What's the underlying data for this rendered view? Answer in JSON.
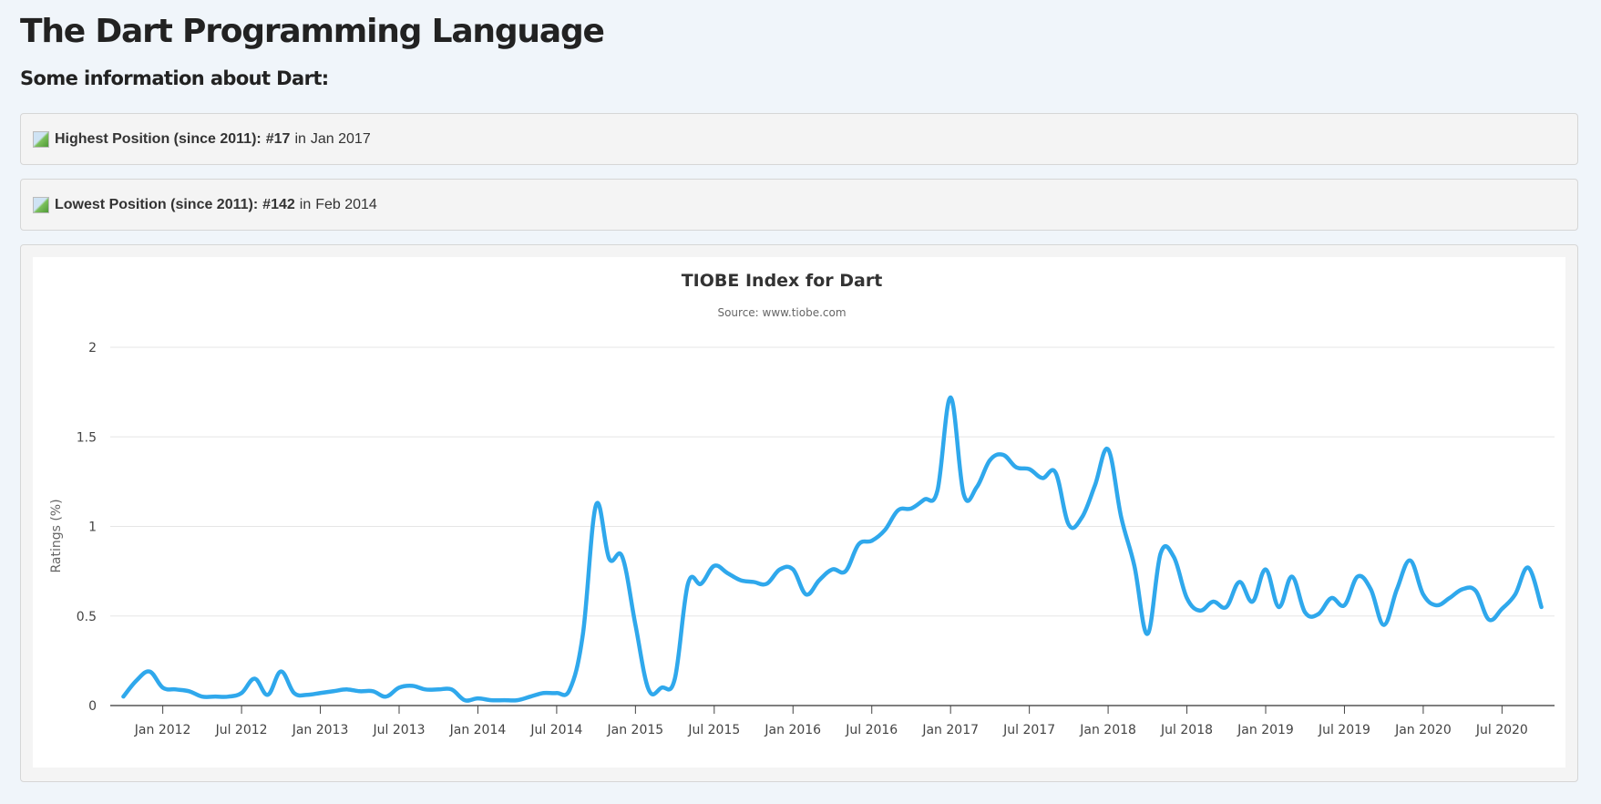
{
  "page": {
    "title": "The Dart Programming Language",
    "subtitle": "Some information about Dart:"
  },
  "highest": {
    "icon": "trend-image-icon",
    "label": "Highest Position (since 2011):",
    "value": "#17",
    "sep": "in",
    "date": "Jan 2017"
  },
  "lowest": {
    "icon": "trend-image-icon",
    "label": "Lowest Position (since 2011):",
    "value": "#142",
    "sep": "in",
    "date": "Feb 2014"
  },
  "chart_data": {
    "type": "line",
    "title": "TIOBE Index for Dart",
    "subtitle": "Source: www.tiobe.com",
    "xlabel": "",
    "ylabel": "Ratings (%)",
    "ylim": [
      0,
      2
    ],
    "xlim": [
      "2011-09",
      "2020-11"
    ],
    "yticks": [
      0,
      0.5,
      1,
      1.5,
      2
    ],
    "ytick_labels": [
      "0",
      "0.5",
      "1",
      "1.5",
      "2"
    ],
    "xticks": [
      "2012-01",
      "2012-07",
      "2013-01",
      "2013-07",
      "2014-01",
      "2014-07",
      "2015-01",
      "2015-07",
      "2016-01",
      "2016-07",
      "2017-01",
      "2017-07",
      "2018-01",
      "2018-07",
      "2019-01",
      "2019-07",
      "2020-01",
      "2020-07"
    ],
    "xtick_labels": [
      "Jan 2012",
      "Jul 2012",
      "Jan 2013",
      "Jul 2013",
      "Jan 2014",
      "Jul 2014",
      "Jan 2015",
      "Jul 2015",
      "Jan 2016",
      "Jul 2016",
      "Jan 2017",
      "Jul 2017",
      "Jan 2018",
      "Jul 2018",
      "Jan 2019",
      "Jul 2019",
      "Jan 2020",
      "Jul 2020"
    ],
    "grid": true,
    "legend": false,
    "series": [
      {
        "color": "#2fa8ec",
        "points": [
          [
            "2011-10",
            0.05
          ],
          [
            "2011-11",
            0.14
          ],
          [
            "2011-12",
            0.19
          ],
          [
            "2012-01",
            0.1
          ],
          [
            "2012-02",
            0.09
          ],
          [
            "2012-03",
            0.08
          ],
          [
            "2012-04",
            0.05
          ],
          [
            "2012-05",
            0.05
          ],
          [
            "2012-06",
            0.05
          ],
          [
            "2012-07",
            0.07
          ],
          [
            "2012-08",
            0.15
          ],
          [
            "2012-09",
            0.06
          ],
          [
            "2012-10",
            0.19
          ],
          [
            "2012-11",
            0.07
          ],
          [
            "2012-12",
            0.06
          ],
          [
            "2013-01",
            0.07
          ],
          [
            "2013-02",
            0.08
          ],
          [
            "2013-03",
            0.09
          ],
          [
            "2013-04",
            0.08
          ],
          [
            "2013-05",
            0.08
          ],
          [
            "2013-06",
            0.05
          ],
          [
            "2013-07",
            0.1
          ],
          [
            "2013-08",
            0.11
          ],
          [
            "2013-09",
            0.09
          ],
          [
            "2013-10",
            0.09
          ],
          [
            "2013-11",
            0.09
          ],
          [
            "2013-12",
            0.03
          ],
          [
            "2014-01",
            0.04
          ],
          [
            "2014-02",
            0.03
          ],
          [
            "2014-03",
            0.03
          ],
          [
            "2014-04",
            0.03
          ],
          [
            "2014-05",
            0.05
          ],
          [
            "2014-06",
            0.07
          ],
          [
            "2014-07",
            0.07
          ],
          [
            "2014-08",
            0.09
          ],
          [
            "2014-09",
            0.4
          ],
          [
            "2014-10",
            1.12
          ],
          [
            "2014-11",
            0.82
          ],
          [
            "2014-12",
            0.83
          ],
          [
            "2015-01",
            0.45
          ],
          [
            "2015-02",
            0.09
          ],
          [
            "2015-03",
            0.1
          ],
          [
            "2015-04",
            0.15
          ],
          [
            "2015-05",
            0.68
          ],
          [
            "2015-06",
            0.68
          ],
          [
            "2015-07",
            0.78
          ],
          [
            "2015-08",
            0.74
          ],
          [
            "2015-09",
            0.7
          ],
          [
            "2015-10",
            0.69
          ],
          [
            "2015-11",
            0.68
          ],
          [
            "2015-12",
            0.76
          ],
          [
            "2016-01",
            0.76
          ],
          [
            "2016-02",
            0.62
          ],
          [
            "2016-03",
            0.7
          ],
          [
            "2016-04",
            0.76
          ],
          [
            "2016-05",
            0.75
          ],
          [
            "2016-06",
            0.9
          ],
          [
            "2016-07",
            0.92
          ],
          [
            "2016-08",
            0.98
          ],
          [
            "2016-09",
            1.09
          ],
          [
            "2016-10",
            1.1
          ],
          [
            "2016-11",
            1.15
          ],
          [
            "2016-12",
            1.2
          ],
          [
            "2017-01",
            1.72
          ],
          [
            "2017-02",
            1.18
          ],
          [
            "2017-03",
            1.22
          ],
          [
            "2017-04",
            1.37
          ],
          [
            "2017-05",
            1.4
          ],
          [
            "2017-06",
            1.33
          ],
          [
            "2017-07",
            1.32
          ],
          [
            "2017-08",
            1.27
          ],
          [
            "2017-09",
            1.3
          ],
          [
            "2017-10",
            1.01
          ],
          [
            "2017-11",
            1.05
          ],
          [
            "2017-12",
            1.23
          ],
          [
            "2018-01",
            1.43
          ],
          [
            "2018-02",
            1.05
          ],
          [
            "2018-03",
            0.78
          ],
          [
            "2018-04",
            0.4
          ],
          [
            "2018-05",
            0.85
          ],
          [
            "2018-06",
            0.83
          ],
          [
            "2018-07",
            0.6
          ],
          [
            "2018-08",
            0.53
          ],
          [
            "2018-09",
            0.58
          ],
          [
            "2018-10",
            0.55
          ],
          [
            "2018-11",
            0.69
          ],
          [
            "2018-12",
            0.58
          ],
          [
            "2019-01",
            0.76
          ],
          [
            "2019-02",
            0.55
          ],
          [
            "2019-03",
            0.72
          ],
          [
            "2019-04",
            0.52
          ],
          [
            "2019-05",
            0.51
          ],
          [
            "2019-06",
            0.6
          ],
          [
            "2019-07",
            0.56
          ],
          [
            "2019-08",
            0.72
          ],
          [
            "2019-09",
            0.65
          ],
          [
            "2019-10",
            0.45
          ],
          [
            "2019-11",
            0.65
          ],
          [
            "2019-12",
            0.81
          ],
          [
            "2020-01",
            0.62
          ],
          [
            "2020-02",
            0.56
          ],
          [
            "2020-03",
            0.6
          ],
          [
            "2020-04",
            0.65
          ],
          [
            "2020-05",
            0.64
          ],
          [
            "2020-06",
            0.48
          ],
          [
            "2020-07",
            0.54
          ],
          [
            "2020-08",
            0.62
          ],
          [
            "2020-09",
            0.77
          ],
          [
            "2020-10",
            0.55
          ]
        ]
      }
    ]
  }
}
